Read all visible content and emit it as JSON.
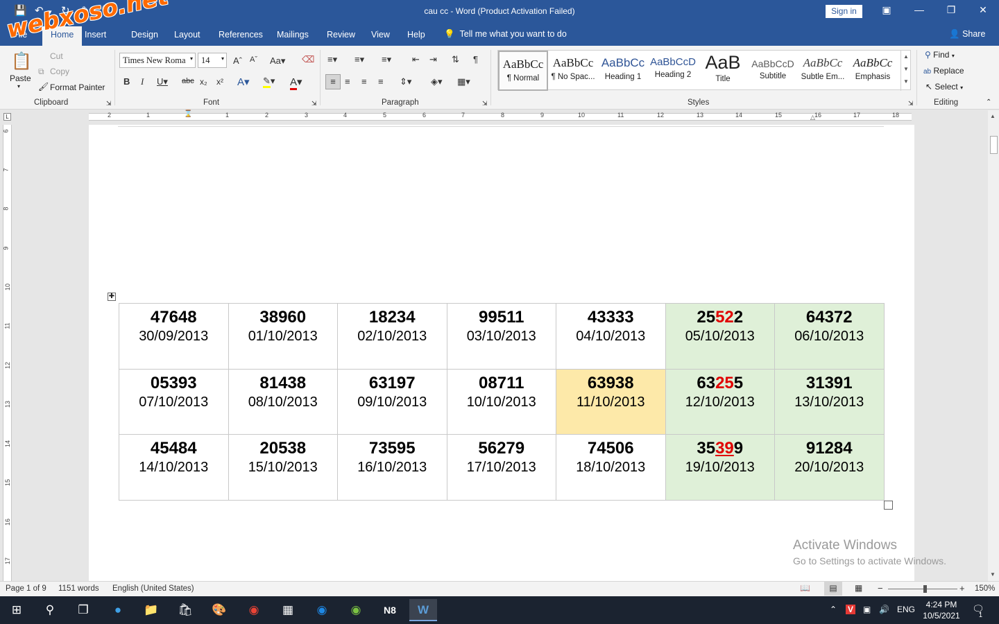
{
  "window": {
    "title": "cau cc  -  Word (Product Activation Failed)",
    "sign_in": "Sign in"
  },
  "watermark_logo": "webxoso.net",
  "tabs": [
    {
      "label": "File"
    },
    {
      "label": "Home"
    },
    {
      "label": "Insert"
    },
    {
      "label": "Design"
    },
    {
      "label": "Layout"
    },
    {
      "label": "References"
    },
    {
      "label": "Mailings"
    },
    {
      "label": "Review"
    },
    {
      "label": "View"
    },
    {
      "label": "Help"
    }
  ],
  "tell_me": "Tell me what you want to do",
  "share": "Share",
  "clipboard": {
    "paste": "Paste",
    "cut": "Cut",
    "copy": "Copy",
    "format_painter": "Format Painter",
    "label": "Clipboard"
  },
  "font": {
    "name": "Times New Roma",
    "size": "14",
    "label": "Font"
  },
  "paragraph": {
    "label": "Paragraph"
  },
  "styles": {
    "label": "Styles",
    "items": [
      {
        "sample": "AaBbCc",
        "name": "¶ Normal"
      },
      {
        "sample": "AaBbCc",
        "name": "¶ No Spac..."
      },
      {
        "sample": "AaBbCc",
        "name": "Heading 1"
      },
      {
        "sample": "AaBbCcD",
        "name": "Heading 2"
      },
      {
        "sample": "AaB",
        "name": "Title"
      },
      {
        "sample": "AaBbCcD",
        "name": "Subtitle"
      },
      {
        "sample": "AaBbCc",
        "name": "Subtle Em..."
      },
      {
        "sample": "AaBbCc",
        "name": "Emphasis"
      }
    ]
  },
  "editing": {
    "find": "Find",
    "replace": "Replace",
    "select": "Select",
    "label": "Editing"
  },
  "ruler": {
    "h_numbers": [
      "2",
      "1",
      "1",
      "2",
      "3",
      "4",
      "5",
      "6",
      "7",
      "8",
      "9",
      "10",
      "11",
      "12",
      "13",
      "14",
      "15",
      "16",
      "17",
      "18"
    ],
    "v_numbers": [
      "6",
      "7",
      "8",
      "9",
      "10",
      "11",
      "12",
      "13",
      "14",
      "15",
      "16",
      "17"
    ]
  },
  "table": {
    "rows": [
      [
        {
          "pre": "47648",
          "hl": "",
          "post": "",
          "date": "30/09/2013",
          "bg": "white"
        },
        {
          "pre": "38960",
          "hl": "",
          "post": "",
          "date": "01/10/2013",
          "bg": "white"
        },
        {
          "pre": "18234",
          "hl": "",
          "post": "",
          "date": "02/10/2013",
          "bg": "white"
        },
        {
          "pre": "99511",
          "hl": "",
          "post": "",
          "date": "03/10/2013",
          "bg": "white"
        },
        {
          "pre": "43333",
          "hl": "",
          "post": "",
          "date": "04/10/2013",
          "bg": "white"
        },
        {
          "pre": "25",
          "hl": "52",
          "post": "2",
          "date": "05/10/2013",
          "bg": "green"
        },
        {
          "pre": "64372",
          "hl": "",
          "post": "",
          "date": "06/10/2013",
          "bg": "green"
        }
      ],
      [
        {
          "pre": "05393",
          "hl": "",
          "post": "",
          "date": "07/10/2013",
          "bg": "white"
        },
        {
          "pre": "81438",
          "hl": "",
          "post": "",
          "date": "08/10/2013",
          "bg": "white"
        },
        {
          "pre": "63197",
          "hl": "",
          "post": "",
          "date": "09/10/2013",
          "bg": "white"
        },
        {
          "pre": "08711",
          "hl": "",
          "post": "",
          "date": "10/10/2013",
          "bg": "white"
        },
        {
          "pre": "63938",
          "hl": "",
          "post": "",
          "date": "11/10/2013",
          "bg": "yellow"
        },
        {
          "pre": "63",
          "hl": "25",
          "post": "5",
          "date": "12/10/2013",
          "bg": "green"
        },
        {
          "pre": "31391",
          "hl": "",
          "post": "",
          "date": "13/10/2013",
          "bg": "green"
        }
      ],
      [
        {
          "pre": "45484",
          "hl": "",
          "post": "",
          "date": "14/10/2013",
          "bg": "white"
        },
        {
          "pre": "20538",
          "hl": "",
          "post": "",
          "date": "15/10/2013",
          "bg": "white"
        },
        {
          "pre": "73595",
          "hl": "",
          "post": "",
          "date": "16/10/2013",
          "bg": "white"
        },
        {
          "pre": "56279",
          "hl": "",
          "post": "",
          "date": "17/10/2013",
          "bg": "white"
        },
        {
          "pre": "74506",
          "hl": "",
          "post": "",
          "date": "18/10/2013",
          "bg": "white"
        },
        {
          "pre": "35",
          "hl": "39",
          "post": "9",
          "date": "19/10/2013",
          "bg": "green",
          "underline": true
        },
        {
          "pre": "91284",
          "hl": "",
          "post": "",
          "date": "20/10/2013",
          "bg": "green"
        }
      ]
    ]
  },
  "activation": {
    "line1": "Activate Windows",
    "line2": "Go to Settings to activate Windows."
  },
  "status": {
    "page": "Page 1 of 9",
    "words": "1151 words",
    "language": "English (United States)",
    "zoom": "150%"
  },
  "taskbar": {
    "time": "4:24 PM",
    "date": "10/5/2021",
    "lang": "ENG",
    "notifications": "1"
  },
  "colors": {
    "word_blue": "#2b579a",
    "highlight_red": "#e00000",
    "cell_green": "#dff0d8",
    "cell_yellow": "#fde9a9",
    "logo_orange": "#ff6a00"
  }
}
